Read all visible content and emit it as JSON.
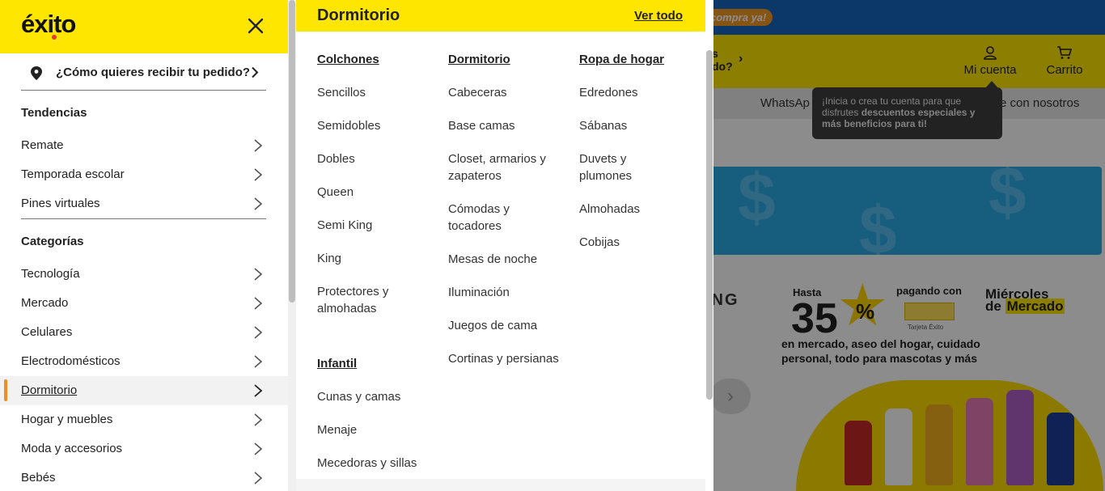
{
  "background": {
    "promo_text": "compra ya!",
    "header_partial": [
      "s",
      "do?"
    ],
    "account_label": "Mi cuenta",
    "cart_label": "Carrito",
    "nav_whatsapp": "WhatsAp",
    "nav_contact": "e con nosotros",
    "tooltip": {
      "line1": "¡Inicia o crea tu cuenta para que",
      "line2_plain": "disfrutes ",
      "line2_bold": "descuentos especiales y",
      "line3_bold": "más beneficios para ti!"
    },
    "ad": {
      "brand_partial": "ING",
      "hasta": "Hasta",
      "discount": "35",
      "percent": "%",
      "pagando_con": "pagando con",
      "card_caption": "Tarjeta Éxito",
      "miercoles": "Miércoles",
      "de": "de ",
      "mercado": "Mercado",
      "line1": "en mercado, aseo del hogar, cuidado",
      "line2": "personal, todo para mascotas y más"
    }
  },
  "drawer": {
    "logo": "éxito",
    "delivery_prompt": "¿Cómo quieres recibir tu pedido?",
    "trends_title": "Tendencias",
    "trends": [
      {
        "label": "Remate"
      },
      {
        "label": "Temporada escolar"
      },
      {
        "label": "Pines virtuales"
      }
    ],
    "categories_title": "Categorías",
    "categories": [
      {
        "label": "Tecnología"
      },
      {
        "label": "Mercado"
      },
      {
        "label": "Celulares"
      },
      {
        "label": "Electrodomésticos"
      },
      {
        "label": "Dormitorio"
      },
      {
        "label": "Hogar y muebles"
      },
      {
        "label": "Moda y accesorios"
      },
      {
        "label": "Bebés"
      }
    ],
    "active_category": "Dormitorio"
  },
  "submenu": {
    "title": "Dormitorio",
    "view_all": "Ver todo",
    "columns": [
      {
        "heading": "Colchones",
        "items": [
          "Sencillos",
          "Semidobles",
          "Dobles",
          "Queen",
          "Semi King",
          "King",
          "Protectores y almohadas"
        ]
      },
      {
        "heading": "Dormitorio",
        "items": [
          "Cabeceras",
          "Base camas",
          "Closet, armarios y zapateros",
          "Cómodas y tocadores",
          "Mesas de noche",
          "Iluminación",
          "Juegos de cama",
          "Cortinas y persianas"
        ]
      },
      {
        "heading": "Ropa de hogar",
        "items": [
          "Edredones",
          "Sábanas",
          "Duvets y plumones",
          "Almohadas",
          "Cobijas"
        ]
      },
      {
        "heading": "Infantil",
        "items": [
          "Cunas y camas",
          "Menaje",
          "Mecedoras y sillas"
        ]
      }
    ]
  },
  "colors": {
    "brand_yellow": "#ffe600",
    "active_indicator": "#f28c28",
    "top_bar_blue": "#1565c0",
    "promo_orange": "#f59a23"
  }
}
